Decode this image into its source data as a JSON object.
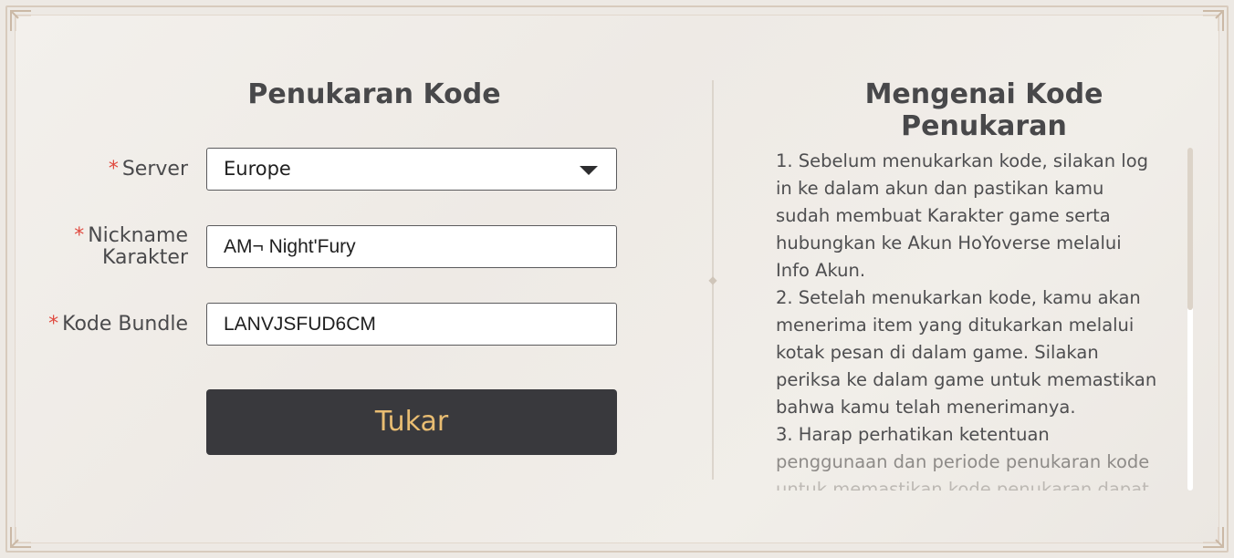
{
  "form": {
    "title": "Penukaran Kode",
    "required_mark": "*",
    "server_label": "Server",
    "server_value": "Europe",
    "nickname_label_line1": "Nickname",
    "nickname_label_line2": "Karakter",
    "nickname_value": "AM¬ Night'Fury",
    "code_label": "Kode Bundle",
    "code_value": "LANVJSFUD6CM",
    "submit_label": "Tukar"
  },
  "info": {
    "title": "Mengenai Kode Penukaran",
    "lines": [
      "1. Sebelum menukarkan kode, silakan log",
      "in ke dalam akun dan pastikan kamu",
      "sudah membuat Karakter game serta",
      "hubungkan ke Akun HoYoverse melalui",
      "Info Akun.",
      "2. Setelah menukarkan kode, kamu akan",
      "menerima item yang ditukarkan melalui",
      "kotak pesan di dalam game. Silakan",
      "periksa ke dalam game untuk memastikan",
      "bahwa kamu telah menerimanya.",
      "3. Harap perhatikan ketentuan",
      "penggunaan dan periode penukaran kode",
      "untuk memastikan kode penukaran dapat"
    ]
  },
  "colors": {
    "accent_button_bg": "#39393d",
    "accent_button_text": "#e9bd72",
    "required": "#e04a3f"
  },
  "icons": {
    "dropdown": "triangle-down-icon",
    "corner": "corner-ornament-icon"
  }
}
